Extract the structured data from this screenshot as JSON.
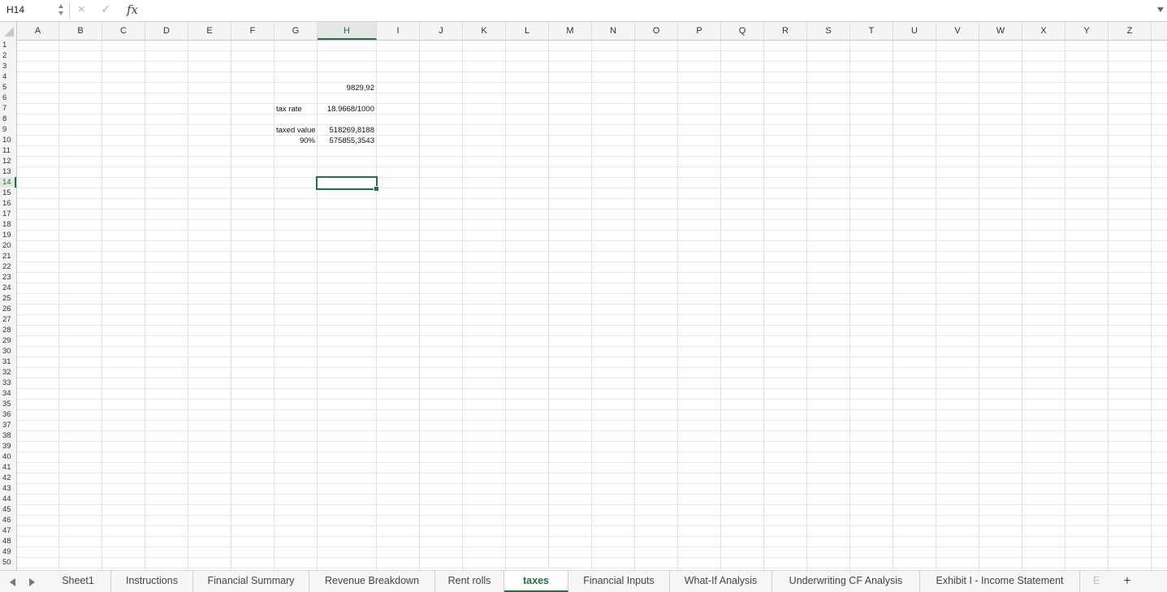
{
  "formula_bar": {
    "name_box": "H14",
    "cancel_icon": "×",
    "enter_icon": "✓",
    "fx_label": "fx",
    "formula": ""
  },
  "columns": [
    "A",
    "B",
    "C",
    "D",
    "E",
    "F",
    "G",
    "H",
    "I",
    "J",
    "K",
    "L",
    "M",
    "N",
    "O",
    "P",
    "Q",
    "R",
    "S",
    "T",
    "U",
    "V",
    "W",
    "X",
    "Y",
    "Z"
  ],
  "active_column": "H",
  "active_row": 14,
  "rows": [
    "1",
    "2",
    "3",
    "4",
    "5",
    "6",
    "7",
    "8",
    "9",
    "10",
    "11",
    "12",
    "13",
    "14",
    "15",
    "16",
    "17",
    "18",
    "19",
    "20",
    "21",
    "22",
    "23",
    "24",
    "25",
    "26",
    "27",
    "28",
    "29",
    "30",
    "31",
    "32",
    "33",
    "34",
    "35",
    "36",
    "37",
    "38",
    "39",
    "40",
    "41",
    "42",
    "43",
    "44",
    "45",
    "46",
    "47",
    "48",
    "49",
    "50"
  ],
  "cells": {
    "H5": "9829,92",
    "G7": "tax rate",
    "H7": "18.9668/1000",
    "G9": "taxed value",
    "H9": "518269,8188",
    "G10": "90%",
    "H10": "575855,3543"
  },
  "sheet_tabs": [
    {
      "label": "Sheet1",
      "active": false
    },
    {
      "label": "Instructions",
      "active": false
    },
    {
      "label": "Financial Summary",
      "active": false
    },
    {
      "label": "Revenue Breakdown",
      "active": false
    },
    {
      "label": "Rent rolls",
      "active": false
    },
    {
      "label": "taxes",
      "active": true
    },
    {
      "label": "Financial Inputs",
      "active": false
    },
    {
      "label": "What-If Analysis",
      "active": false
    },
    {
      "label": "Underwriting CF Analysis",
      "active": false
    },
    {
      "label": "Exhibit I - Income Statement",
      "active": false
    },
    {
      "label": "E",
      "active": false
    }
  ],
  "add_sheet_label": "+",
  "colors": {
    "accent": "#217346"
  }
}
